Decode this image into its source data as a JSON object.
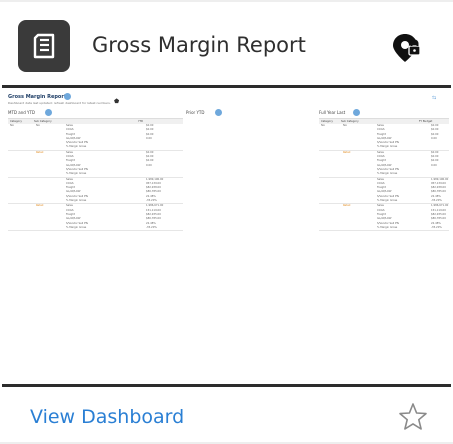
{
  "card": {
    "title": "Gross Margin Report",
    "view_link": "View Dashboard",
    "icons": {
      "app": "report-icon",
      "pin": "location-pin-lock-icon",
      "favorite": "star-outline-icon"
    }
  },
  "preview": {
    "title": "Gross Margin Report",
    "subtitle": "Dashboard data last updated: refresh dashboard for latest numbers.",
    "sections": [
      "MTD and YTD",
      "Prior YTD",
      "Full Year Last"
    ],
    "headers": [
      "Category",
      "Sub Category",
      "",
      "YTD"
    ],
    "headers_last": [
      "Category",
      "Sub Category",
      "",
      "FY Budget"
    ],
    "row_labels": [
      "Sales",
      "COGS",
      "Freight",
      "GL/AP/LOW",
      "S/Vendor Sell PTs",
      "% Margin Gross"
    ],
    "group1": {
      "cat": "NA",
      "sub": "NA",
      "alt": "Retail"
    },
    "group2": {
      "alt": "Retail"
    },
    "values_a": [
      "$0.00",
      "$0.00",
      "$0.00",
      "0.00",
      "",
      "",
      "$0.00",
      "$0.00",
      "$0.00",
      "0.00",
      "",
      ""
    ],
    "values_b": [
      "1,989,196.00",
      "957,139.00",
      "$82,938.00",
      "$80,785.00",
      "22.48%",
      "-35.20%",
      "1,986,671.00",
      "151,119.00",
      "$82,935.00",
      "$80,785.00",
      "22.48%",
      "-35.20%"
    ]
  },
  "colors": {
    "link": "#2a7fd4",
    "icon_bg": "#3a3a3a",
    "rule": "#2c2c2c"
  }
}
